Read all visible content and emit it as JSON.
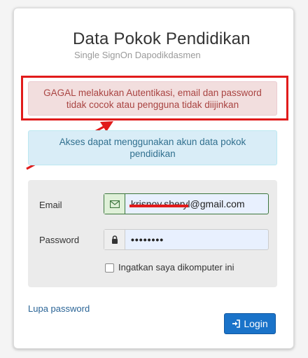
{
  "header": {
    "title": "Data Pokok Pendidikan",
    "subtitle": "Single SignOn Dapodikdasmen"
  },
  "alerts": {
    "error": "GAGAL melakukan Autentikasi, email dan password tidak cocok atau pengguna tidak diijinkan",
    "info": "Akses dapat menggunakan akun data pokok pendidikan"
  },
  "form": {
    "email_label": "Email",
    "email_value": "krisnov.sheryl@gmail.com",
    "password_label": "Password",
    "password_value": "••••••••",
    "remember_label": "Ingatkan saya dikomputer ini",
    "remember_checked": false
  },
  "footer": {
    "forgot_password": "Lupa password",
    "login_label": "Login"
  },
  "colors": {
    "error_bg": "#f2dede",
    "error_text": "#a94442",
    "info_bg": "#d9edf7",
    "info_text": "#31708f",
    "annotation_red": "#e11b1b",
    "primary_button": "#1a73c9"
  },
  "icons": {
    "email": "envelope-icon",
    "password": "lock-icon",
    "login": "sign-in-icon"
  }
}
